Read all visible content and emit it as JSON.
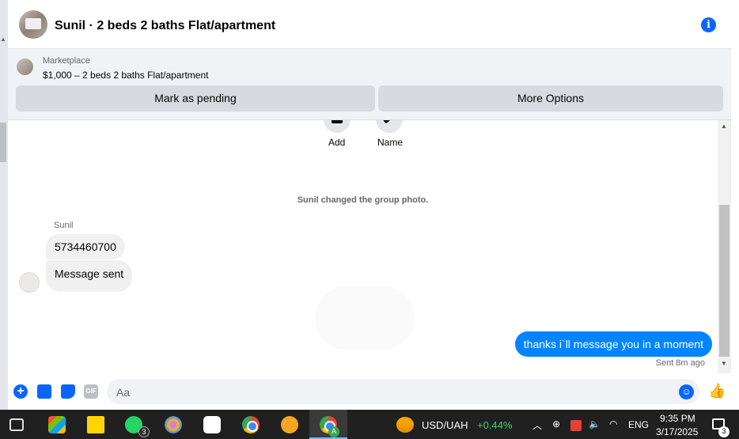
{
  "header": {
    "title": "Sunil · 2 beds 2 baths Flat/apartment"
  },
  "listing": {
    "source": "Marketplace",
    "summary": "$1,000 – 2 beds 2 baths Flat/apartment",
    "mark_pending": "Mark as pending",
    "more_options": "More Options"
  },
  "chat": {
    "actions": [
      {
        "label": "Add"
      },
      {
        "label": "Name"
      }
    ],
    "system_message": "Sunil changed the group photo.",
    "sender": "Sunil",
    "incoming": [
      "5734460700",
      "Message sent"
    ],
    "outgoing": "thanks i`ll message you in a moment",
    "outgoing_status": "Sent 8m ago"
  },
  "composer": {
    "placeholder": "Aa",
    "gif_label": "GIF"
  },
  "taskbar": {
    "whatsapp_badge": "3",
    "chrome_profile": "A",
    "fx_pair": "USD/UAH",
    "fx_change": "+0.44%",
    "language": "ENG",
    "time": "9:35 PM",
    "date": "3/17/2025",
    "notification_count": "3"
  },
  "colors": {
    "accent": "#0866ff",
    "outgoing_bubble": "#0084ff",
    "fx_up": "#3bd16f"
  }
}
